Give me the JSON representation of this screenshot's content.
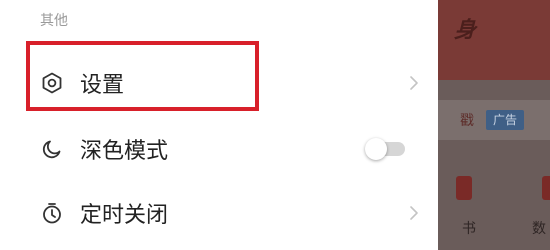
{
  "drawer": {
    "section_title": "其他",
    "items": [
      {
        "label": "设置",
        "icon": "hexagon-settings-icon",
        "trailing": "chevron",
        "highlighted": true
      },
      {
        "label": "深色模式",
        "icon": "moon-icon",
        "trailing": "toggle",
        "toggle_on": false
      },
      {
        "label": "定时关闭",
        "icon": "timer-icon",
        "trailing": "chevron"
      }
    ]
  },
  "background_app": {
    "banner_fragment": "身",
    "strip_fragment": "戳",
    "ad_tag": "广告",
    "tile_labels": [
      "书",
      "数"
    ]
  },
  "colors": {
    "highlight_border": "#d8202a",
    "section_title": "#9a9a9a",
    "label_text": "#222222",
    "ad_tag_bg": "#3f5f86"
  }
}
